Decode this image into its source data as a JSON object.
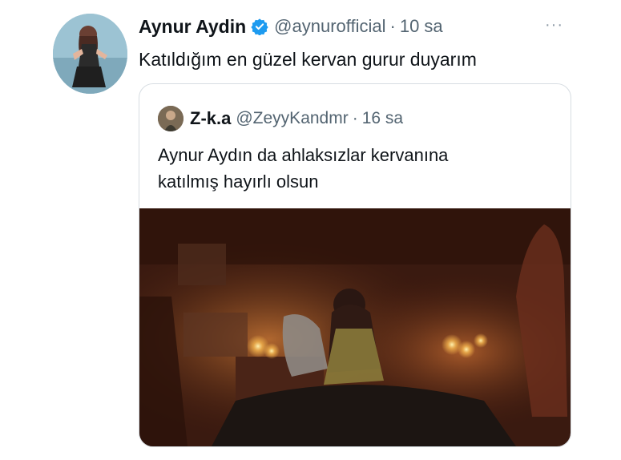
{
  "tweet": {
    "author_name": "Aynur Aydin",
    "author_handle": "@aynurofficial",
    "separator": "·",
    "time": "10 sa",
    "more_label": "···",
    "text": "Katıldığım en güzel kervan gurur duyarım",
    "verified_icon": "verified-badge-icon",
    "colors": {
      "verified": "#1d9bf0",
      "muted": "#536471"
    }
  },
  "quoted_tweet": {
    "author_name": "Z-k.a",
    "author_handle": "@ZeyyKandmr",
    "separator": "·",
    "time": "16 sa",
    "text_lines": [
      "Aynur Aydın da ahlaksızlar kervanına",
      "katılmış hayırlı olsun"
    ]
  }
}
